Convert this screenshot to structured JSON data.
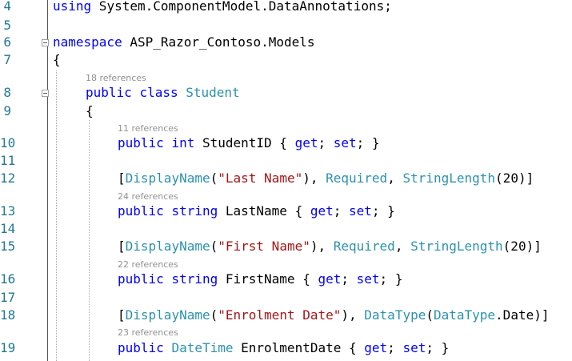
{
  "lines": [
    {
      "num": "4",
      "parts": [
        "using",
        " System.ComponentModel.DataAnnotations;"
      ]
    },
    {
      "num": "5"
    },
    {
      "num": "6",
      "parts": [
        "namespace",
        " ASP_Razor_Contoso.Models"
      ]
    },
    {
      "num": "7",
      "parts": [
        "{"
      ]
    },
    {
      "num": "8",
      "lens": "18 references",
      "parts": [
        "public",
        " ",
        "class",
        " ",
        "Student"
      ]
    },
    {
      "num": "9",
      "parts": [
        "{"
      ]
    },
    {
      "num": "10",
      "lens": "11 references",
      "parts": [
        "public",
        " ",
        "int",
        " StudentID { ",
        "get",
        "; ",
        "set",
        "; }"
      ]
    },
    {
      "num": "11"
    },
    {
      "num": "12",
      "parts": [
        "[",
        "DisplayName",
        "(",
        "\"Last Name\"",
        "), ",
        "Required",
        ", ",
        "StringLength",
        "(20)]"
      ]
    },
    {
      "num": "13",
      "lens": "24 references",
      "parts": [
        "public",
        " ",
        "string",
        " LastName { ",
        "get",
        "; ",
        "set",
        "; }"
      ]
    },
    {
      "num": "14"
    },
    {
      "num": "15",
      "parts": [
        "[",
        "DisplayName",
        "(",
        "\"First Name\"",
        "), ",
        "Required",
        ", ",
        "StringLength",
        "(20)]"
      ]
    },
    {
      "num": "16",
      "lens": "22 references",
      "parts": [
        "public",
        " ",
        "string",
        " FirstName { ",
        "get",
        "; ",
        "set",
        "; }"
      ]
    },
    {
      "num": "17"
    },
    {
      "num": "18",
      "parts": [
        "[",
        "DisplayName",
        "(",
        "\"Enrolment Date\"",
        "), ",
        "DataType",
        "(",
        "DataType",
        ".Date)]"
      ]
    },
    {
      "num": "19",
      "lens": "23 references",
      "parts": [
        "public",
        " ",
        "DateTime",
        " EnrolmentDate { ",
        "get",
        "; ",
        "set",
        "; }"
      ]
    }
  ],
  "colors": {
    "keyword": "#0000ff",
    "type": "#2b91af",
    "string": "#a31515",
    "text": "#000000",
    "line_number": "#237893",
    "code_lens": "#919191"
  }
}
